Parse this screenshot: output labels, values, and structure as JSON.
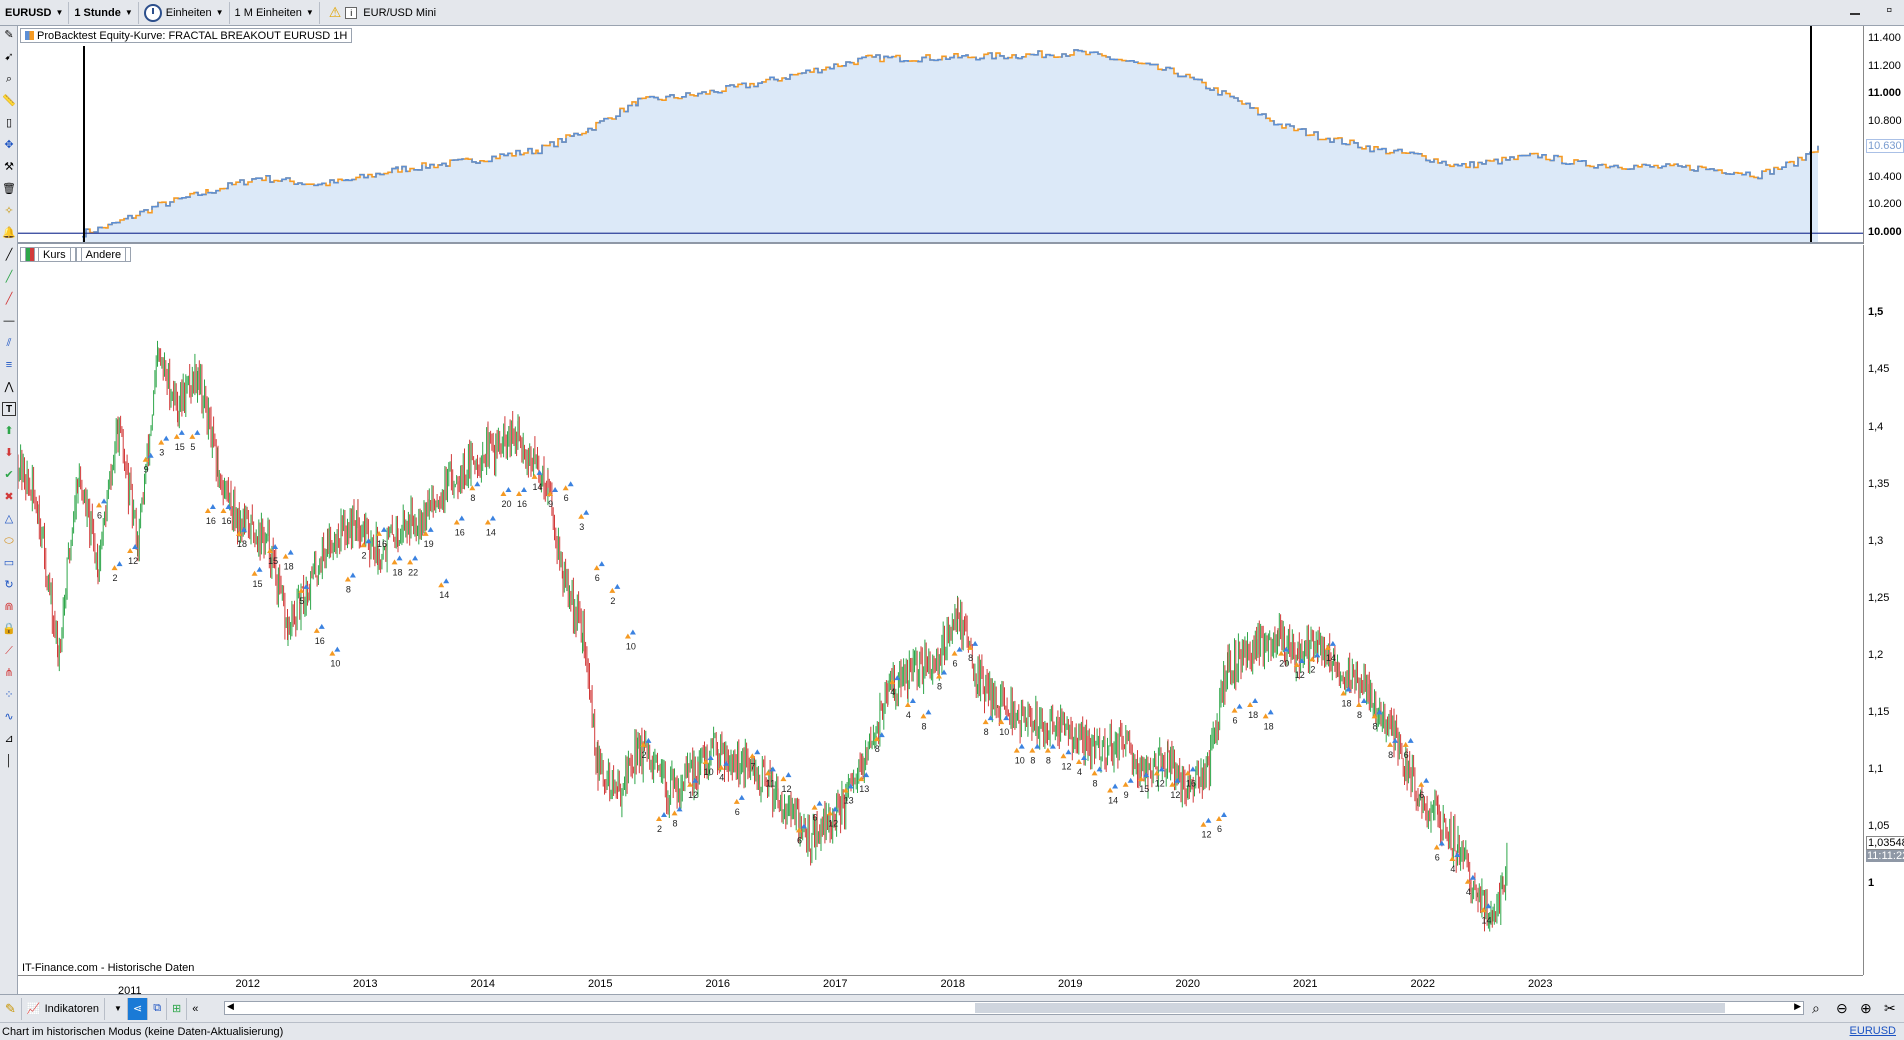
{
  "toolbar": {
    "symbol": "EURUSD",
    "timeframe": "1 Stunde",
    "units_label": "Einheiten",
    "units_value": "1 M Einheiten",
    "instrument": "EUR/USD Mini"
  },
  "equity_panel": {
    "label": "ProBacktest Equity-Kurve: FRACTAL BREAKOUT EURUSD 1H",
    "axis_ticks": [
      "11.400",
      "11.200",
      "11.000",
      "10.800",
      "10.630",
      "10.400",
      "10.200",
      "10.000"
    ],
    "current_value": "10.630",
    "line_color": "#5b8fd6",
    "accent_color": "#f59a23",
    "fill_color": "#dce9f8"
  },
  "price_panel": {
    "labels": [
      "Kurs",
      "Andere"
    ],
    "axis_ticks": [
      "1,5",
      "1,45",
      "1,4",
      "1,35",
      "1,3",
      "1,25",
      "1,2",
      "1,15",
      "1,1",
      "1,05",
      "1"
    ],
    "current_price": "1,03548",
    "current_time": "11:11:22",
    "up_color": "#2ea64a",
    "down_color": "#d23a3a",
    "source": "IT-Finance.com - Historische Daten"
  },
  "time_axis": [
    "2011",
    "2012",
    "2013",
    "2014",
    "2015",
    "2016",
    "2017",
    "2018",
    "2019",
    "2020",
    "2021",
    "2022",
    "2023"
  ],
  "bottom_bar": {
    "indicators_label": "Indikatoren"
  },
  "statusbar": {
    "text": "Chart im historischen Modus (keine Daten-Aktualisierung)",
    "right": "EURUSD"
  },
  "signals": [
    {
      "v": 1.33,
      "n": "6"
    },
    {
      "v": 1.275,
      "n": "2"
    },
    {
      "v": 1.29,
      "n": "12"
    },
    {
      "v": 1.37,
      "n": "9"
    },
    {
      "v": 1.385,
      "n": "3"
    },
    {
      "v": 1.39,
      "n": "15"
    },
    {
      "v": 1.39,
      "n": "5"
    },
    {
      "v": 1.325,
      "n": "16"
    },
    {
      "v": 1.325,
      "n": "16"
    },
    {
      "v": 1.305,
      "n": "18"
    },
    {
      "v": 1.27,
      "n": "15"
    },
    {
      "v": 1.29,
      "n": "15"
    },
    {
      "v": 1.285,
      "n": "18"
    },
    {
      "v": 1.255,
      "n": "5"
    },
    {
      "v": 1.22,
      "n": "16"
    },
    {
      "v": 1.2,
      "n": "10"
    },
    {
      "v": 1.265,
      "n": "8"
    },
    {
      "v": 1.295,
      "n": "2"
    },
    {
      "v": 1.305,
      "n": "16"
    },
    {
      "v": 1.28,
      "n": "18"
    },
    {
      "v": 1.28,
      "n": "22"
    },
    {
      "v": 1.305,
      "n": "19"
    },
    {
      "v": 1.26,
      "n": "14"
    },
    {
      "v": 1.315,
      "n": "16"
    },
    {
      "v": 1.345,
      "n": "8"
    },
    {
      "v": 1.315,
      "n": "14"
    },
    {
      "v": 1.34,
      "n": "20"
    },
    {
      "v": 1.34,
      "n": "16"
    },
    {
      "v": 1.355,
      "n": "14"
    },
    {
      "v": 1.34,
      "n": "9"
    },
    {
      "v": 1.345,
      "n": "6"
    },
    {
      "v": 1.32,
      "n": "3"
    },
    {
      "v": 1.275,
      "n": "6"
    },
    {
      "v": 1.255,
      "n": "2"
    },
    {
      "v": 1.215,
      "n": "10"
    },
    {
      "v": 1.12,
      "n": "2"
    },
    {
      "v": 1.055,
      "n": "2"
    },
    {
      "v": 1.06,
      "n": "8"
    },
    {
      "v": 1.085,
      "n": "12"
    },
    {
      "v": 1.105,
      "n": "10"
    },
    {
      "v": 1.1,
      "n": "4"
    },
    {
      "v": 1.07,
      "n": "6"
    },
    {
      "v": 1.11,
      "n": "7"
    },
    {
      "v": 1.095,
      "n": "11"
    },
    {
      "v": 1.09,
      "n": "12"
    },
    {
      "v": 1.045,
      "n": "6"
    },
    {
      "v": 1.065,
      "n": "6"
    },
    {
      "v": 1.06,
      "n": "12"
    },
    {
      "v": 1.08,
      "n": "13"
    },
    {
      "v": 1.09,
      "n": "13"
    },
    {
      "v": 1.125,
      "n": "8"
    },
    {
      "v": 1.175,
      "n": "4"
    },
    {
      "v": 1.155,
      "n": "4"
    },
    {
      "v": 1.145,
      "n": "8"
    },
    {
      "v": 1.18,
      "n": "8"
    },
    {
      "v": 1.2,
      "n": "6"
    },
    {
      "v": 1.205,
      "n": "8"
    },
    {
      "v": 1.14,
      "n": "8"
    },
    {
      "v": 1.14,
      "n": "10"
    },
    {
      "v": 1.115,
      "n": "10"
    },
    {
      "v": 1.115,
      "n": "8"
    },
    {
      "v": 1.115,
      "n": "8"
    },
    {
      "v": 1.11,
      "n": "12"
    },
    {
      "v": 1.105,
      "n": "4"
    },
    {
      "v": 1.095,
      "n": "8"
    },
    {
      "v": 1.08,
      "n": "14"
    },
    {
      "v": 1.085,
      "n": "9"
    },
    {
      "v": 1.09,
      "n": "15"
    },
    {
      "v": 1.095,
      "n": "12"
    },
    {
      "v": 1.085,
      "n": "12"
    },
    {
      "v": 1.095,
      "n": "16"
    },
    {
      "v": 1.05,
      "n": "12"
    },
    {
      "v": 1.055,
      "n": "6"
    },
    {
      "v": 1.15,
      "n": "6"
    },
    {
      "v": 1.155,
      "n": "18"
    },
    {
      "v": 1.145,
      "n": "18"
    },
    {
      "v": 1.2,
      "n": "20"
    },
    {
      "v": 1.19,
      "n": "12"
    },
    {
      "v": 1.195,
      "n": "2"
    },
    {
      "v": 1.205,
      "n": "14"
    },
    {
      "v": 1.165,
      "n": "18"
    },
    {
      "v": 1.155,
      "n": "8"
    },
    {
      "v": 1.145,
      "n": "8"
    },
    {
      "v": 1.12,
      "n": "8"
    },
    {
      "v": 1.12,
      "n": "6"
    },
    {
      "v": 1.085,
      "n": "6"
    },
    {
      "v": 1.03,
      "n": "6"
    },
    {
      "v": 1.02,
      "n": "4"
    },
    {
      "v": 1.0,
      "n": "4"
    },
    {
      "v": 0.975,
      "n": "14"
    }
  ]
}
